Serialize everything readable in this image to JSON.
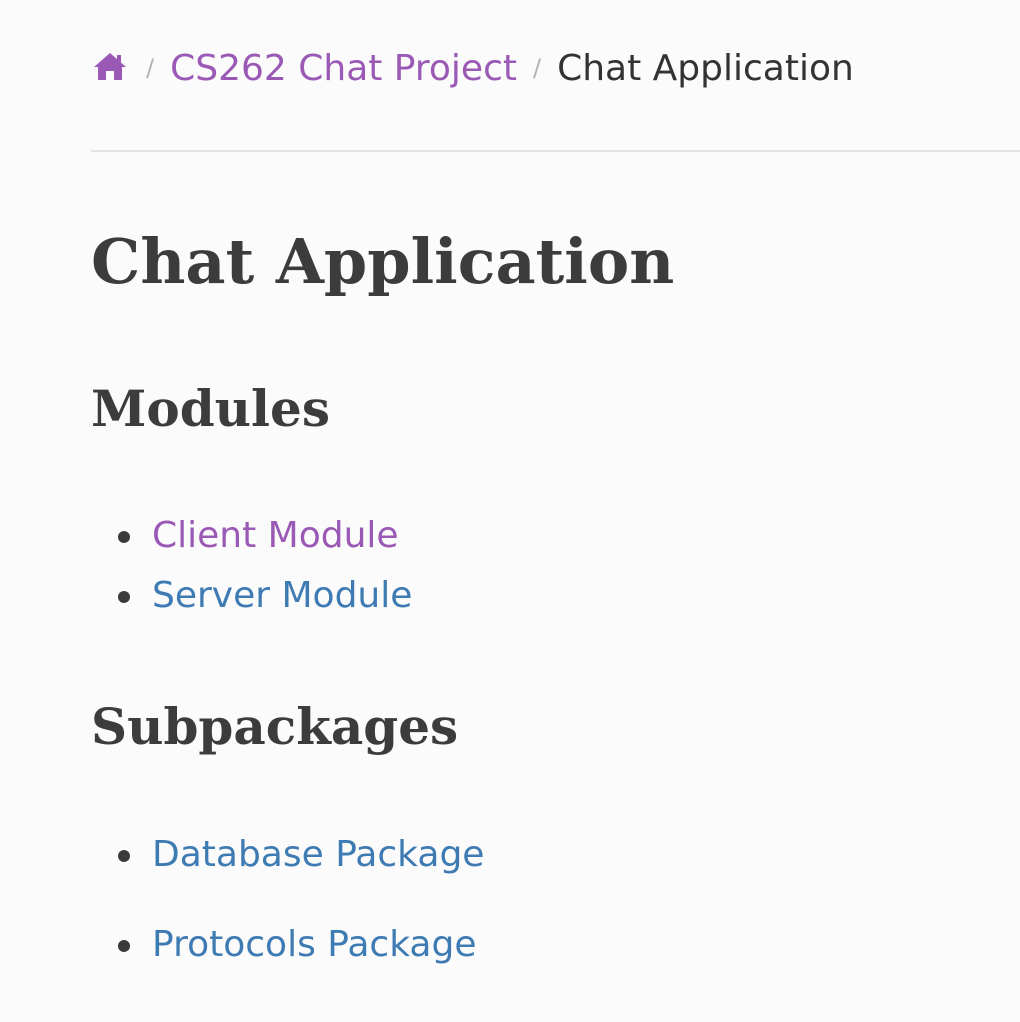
{
  "breadcrumb": {
    "home_icon": "home-icon",
    "separator": "/",
    "project_link": "CS262 Chat Project",
    "current": "Chat Application"
  },
  "page": {
    "title": "Chat Application"
  },
  "modules": {
    "heading": "Modules",
    "items": [
      {
        "label": "Client Module",
        "state": "visited"
      },
      {
        "label": "Server Module",
        "state": "unvisited"
      }
    ]
  },
  "subpackages": {
    "heading": "Subpackages",
    "items": [
      {
        "label": "Database Package",
        "state": "unvisited"
      },
      {
        "label": "Protocols Package",
        "state": "unvisited"
      }
    ]
  },
  "colors": {
    "visited_link": "#9b59b6",
    "link": "#3f7bb3",
    "text": "#3c3c3c",
    "background": "#fbfbfb"
  }
}
